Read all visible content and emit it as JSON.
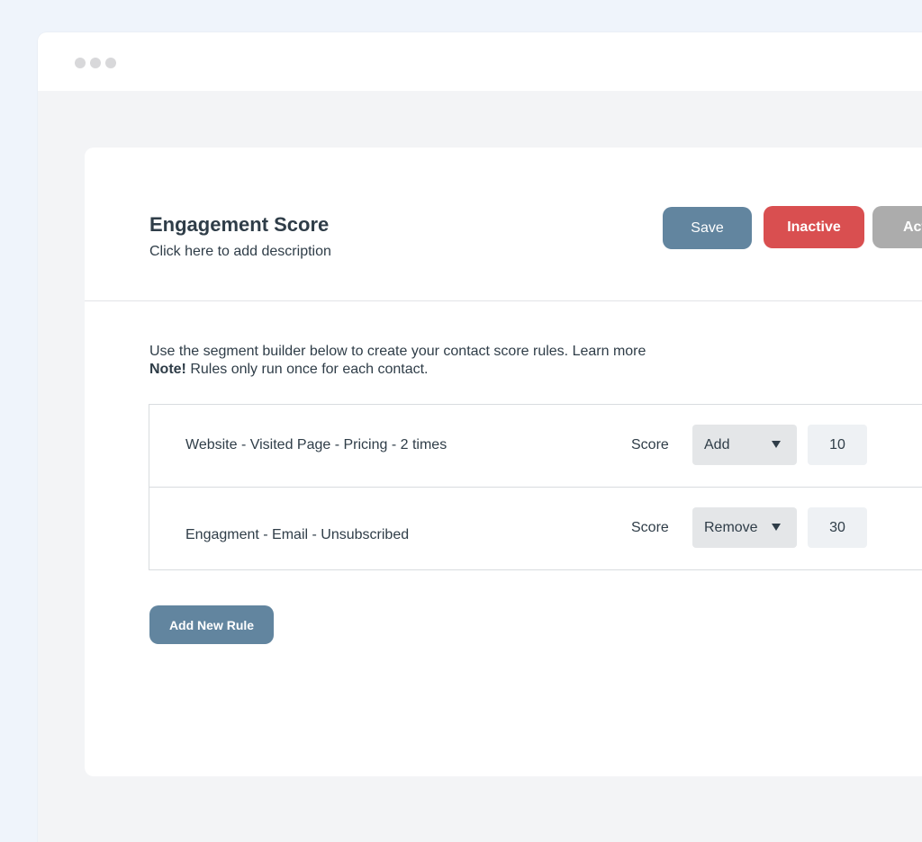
{
  "page": {
    "title": "Engagement Score",
    "description_placeholder": "Click here to add description"
  },
  "actions": {
    "save_label": "Save",
    "inactive_label": "Inactive",
    "active_label": "Active"
  },
  "intro": {
    "text": "Use the segment builder below to create your contact score rules.",
    "learn_more": "Learn more",
    "note_label": "Note!",
    "note_text": "Rules only run once for each contact."
  },
  "rules": [
    {
      "description": "Website - Visited Page - Pricing - 2 times",
      "score_label": "Score",
      "operation": "Add",
      "value": "10"
    },
    {
      "description": "Engagment - Email - Unsubscribed",
      "score_label": "Score",
      "operation": "Remove",
      "value": "30"
    }
  ],
  "add_rule_label": "Add New Rule",
  "colors": {
    "primary": "#62859f",
    "danger": "#d94f50",
    "neutral": "#acacac",
    "text": "#2f3d48"
  }
}
